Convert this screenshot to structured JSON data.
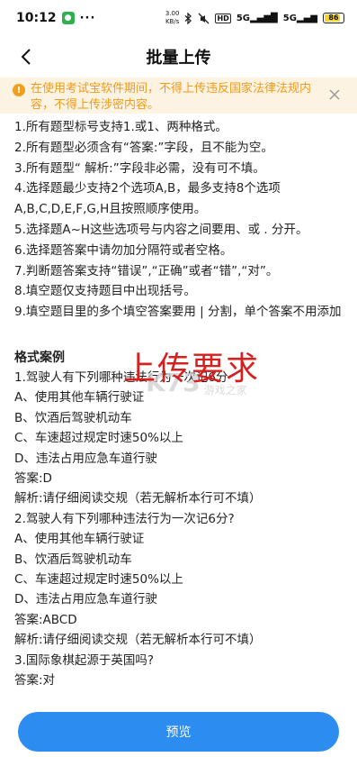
{
  "status": {
    "time": "10:12",
    "netspeed_value": "3.00",
    "netspeed_unit": "KB/s",
    "hd": "HD",
    "sig1": "5G",
    "sig2": "5G",
    "battery": "86"
  },
  "nav": {
    "title": "批量上传",
    "back_icon": "chevron-left-icon"
  },
  "notice": {
    "text": "在使用考试宝软件期间，不得上传违反国家法律法规内容，不得上传涉密内容。",
    "color": "#f09a1a",
    "bg": "#fdf3e2"
  },
  "rules": [
    "1.所有题型标号支持1.或1、两种格式。",
    "2.所有题型必须含有“答案:”字段，且不能为空。",
    "3.所有题型“ 解析:”字段非必需，没有可不填。",
    "4.选择题最少支持2个选项A,B，最多支持8个选项A,B,C,D,E,F,G,H且按照顺序使用。",
    "5.选择题A~H这些选项号与内容之间要用、或 . 分开。",
    "6.选择题答案中请勿加分隔符或者空格。",
    "7.判断题答案支持“错误”,“正确”或者“错”,“对”。",
    "8.填空题仅支持题目中出现括号。",
    "9.填空题目里的多个填空答案要用 | 分割，单个答案不用添加"
  ],
  "example": {
    "title": "格式案例",
    "lines": [
      "1.驾驶人有下列哪种违法行为一次记6分",
      "A、使用其他车辆行驶证",
      "B、饮酒后驾驶机动车",
      "C、车速超过规定时速50%以上",
      "D、违法占用应急车道行驶",
      "答案:D",
      "解析:请仔细阅读交规（若无解析本行可不填）",
      "2.驾驶人有下列哪种违法行为一次记6分?",
      "A、使用其他车辆行驶证",
      "B、饮酒后驾驶机动车",
      "C、车速超过规定时速50%以上",
      "D、违法占用应急车道行驶",
      "答案:ABCD",
      "解析:请仔细阅读交规（若无解析本行可不填）",
      "3.国际象棋起源于英国吗?",
      "答案:对"
    ]
  },
  "overlay": {
    "red_text": "上传要求",
    "logo_text": "K73",
    "logo_sub": "游戏之家"
  },
  "footer": {
    "button_label": "预览",
    "button_color": "#2d8cf0"
  }
}
